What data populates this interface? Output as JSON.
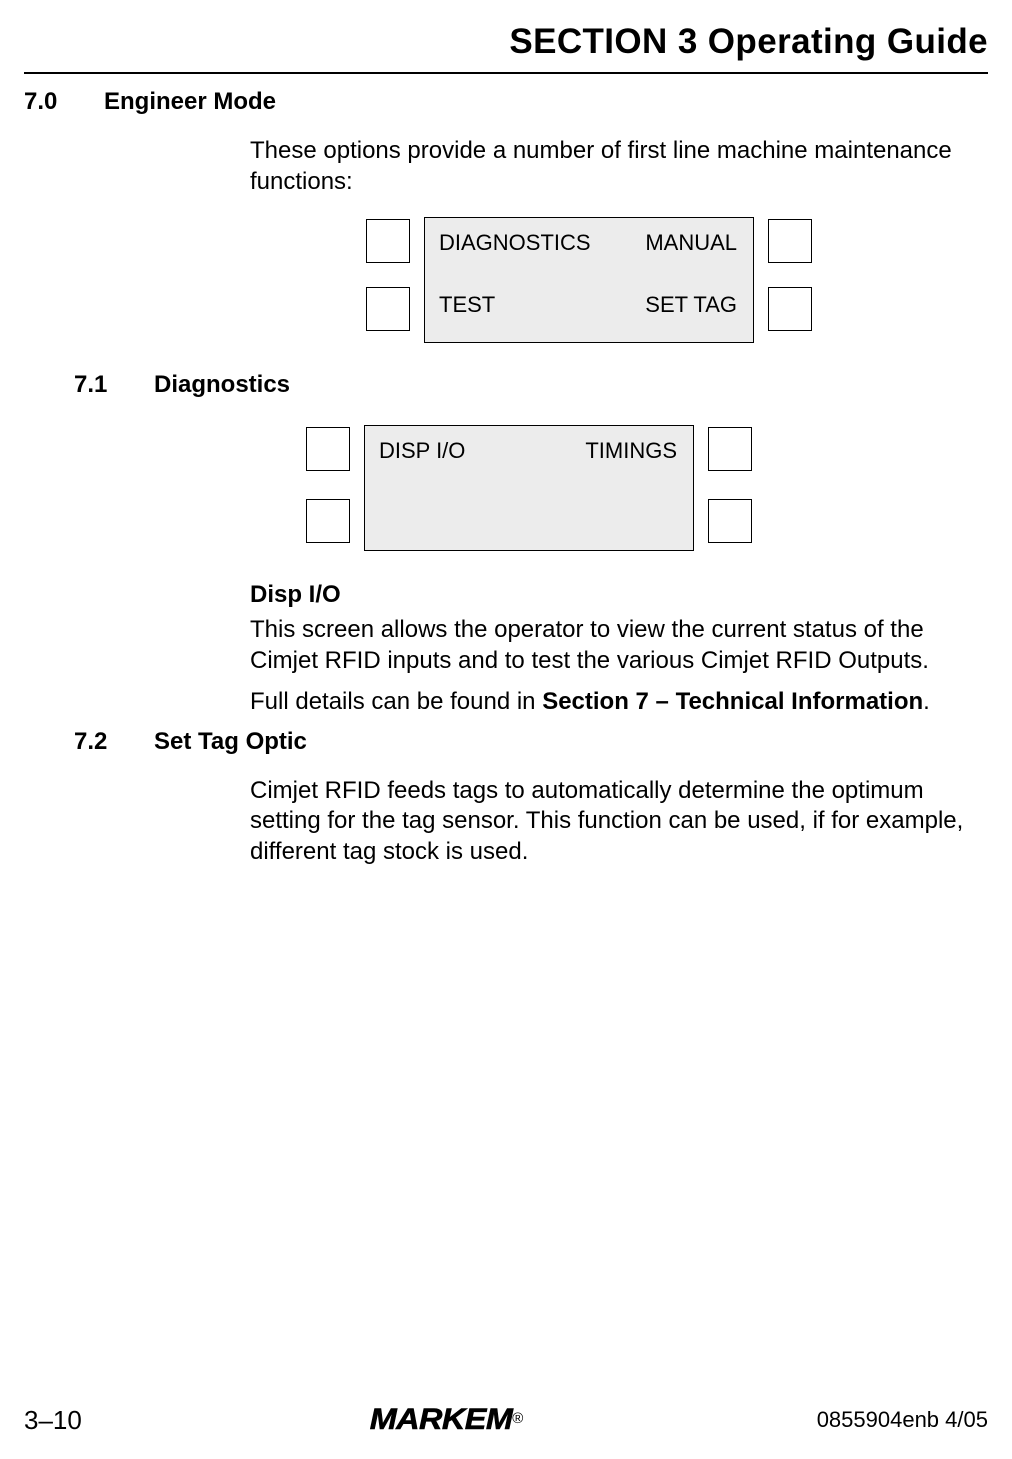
{
  "header": {
    "title": "SECTION 3 Operating Guide"
  },
  "s7_0": {
    "num": "7.0",
    "title": "Engineer Mode",
    "intro": "These options provide a number of first line machine maintenance functions:",
    "screen": {
      "row1_left": "DIAGNOSTICS",
      "row1_right": "MANUAL",
      "row2_left": "TEST",
      "row2_right": "SET TAG"
    }
  },
  "s7_1": {
    "num": "7.1",
    "title": "Diagnostics",
    "screen": {
      "row1_left": "DISP I/O",
      "row1_right": "TIMINGS"
    },
    "disp_heading": "Disp I/O",
    "disp_p1": "This screen allows the operator to view the current status of the Cimjet RFID inputs and to test the various Cimjet RFID Outputs.",
    "disp_p2_pre": "Full details can be found in ",
    "disp_p2_bold": "Section 7 – Technical Information",
    "disp_p2_post": "."
  },
  "s7_2": {
    "num": "7.2",
    "title": "Set Tag Optic",
    "p1": "Cimjet RFID feeds tags to automatically determine the optimum setting for the tag sensor. This function can be used, if for example, different tag stock is used."
  },
  "footer": {
    "left": "3–10",
    "brand": "MARKEM",
    "reg": "®",
    "right": "0855904enb 4/05"
  }
}
